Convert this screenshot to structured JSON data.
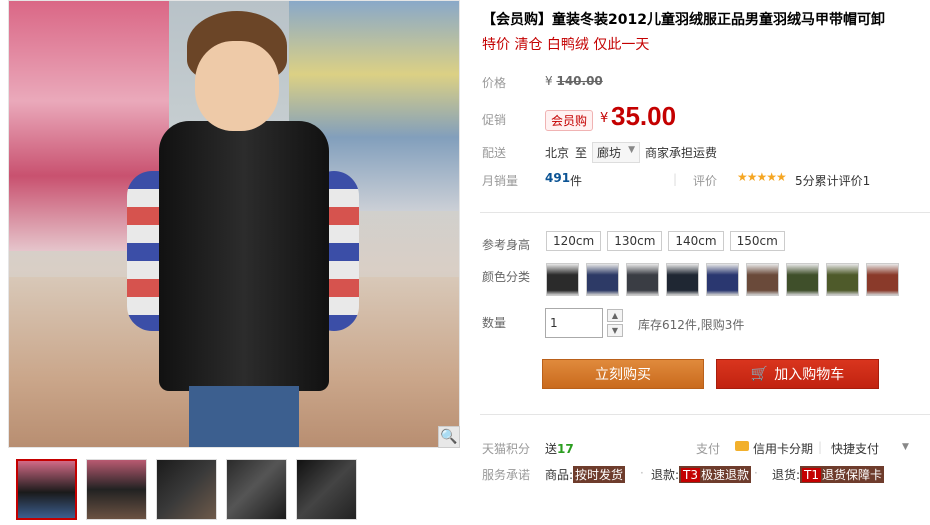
{
  "product": {
    "title": "【会员购】童装冬装2012儿童羽绒服正品男童羽绒马甲带帽可卸",
    "subtitle": "特价 清仓 白鸭绒 仅此一天"
  },
  "price": {
    "label": "价格",
    "currency": "¥",
    "original": "140.00"
  },
  "promo": {
    "label": "促销",
    "badge": "会员购",
    "currency": "¥",
    "price": "35.00"
  },
  "shipping": {
    "label": "配送",
    "from": "北京",
    "to_word": "至",
    "city": "廊坊",
    "fee_text": "商家承担运费"
  },
  "sales": {
    "label": "月销量",
    "count": "491",
    "unit": "件",
    "separator": "|",
    "rating_label": "评价",
    "stars": "★★★★★",
    "rating_text": "5分累计评价1"
  },
  "sku": {
    "size_label": "参考身高",
    "sizes": [
      "120cm",
      "130cm",
      "140cm",
      "150cm"
    ],
    "color_label": "颜色分类",
    "swatch_colors": [
      "#2b2b2b",
      "#2d3a66",
      "#3a3d44",
      "#1f2733",
      "#2a3770",
      "#6a4a3a",
      "#3f4f2a",
      "#4e5a2a",
      "#8a3a2a"
    ]
  },
  "quantity": {
    "label": "数量",
    "value": "1",
    "up": "▲",
    "down": "▼",
    "stock_text": "库存612件,限购3件"
  },
  "actions": {
    "buy_now": "立刻购买",
    "add_to_cart": "加入购物车"
  },
  "points": {
    "label": "天猫积分",
    "prefix": "送",
    "value": "17"
  },
  "payment": {
    "label": "支付",
    "card_text": "信用卡分期",
    "separator": "|",
    "fast_pay": "快捷支付",
    "arrow": "▼"
  },
  "services": {
    "label": "服务承诺",
    "goods_label": "商品:",
    "goods_tag": "按时发货",
    "refund_label": "退款:",
    "refund_code": "T3",
    "refund_tag": "极速退款",
    "return_label": "退货:",
    "return_code": "T1",
    "return_tag": "退货保障卡",
    "dot": "·"
  },
  "icons": {
    "zoom": "🔍",
    "cart": "🛒"
  }
}
